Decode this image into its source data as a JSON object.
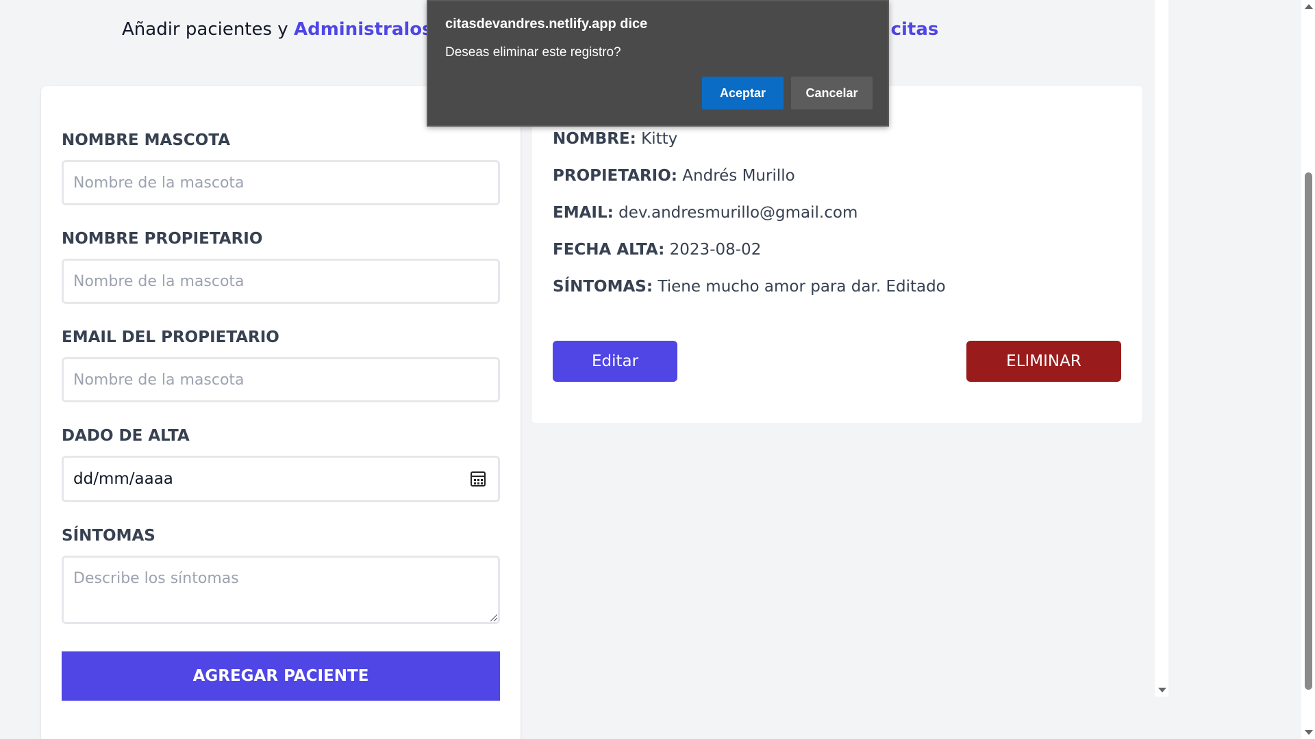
{
  "header": {
    "left_prefix": "Añadir pacientes y ",
    "left_accent": "Administralos",
    "right_accent": "tes y citas"
  },
  "form": {
    "pet_name_label": "NOMBRE MASCOTA",
    "pet_name_placeholder": "Nombre de la mascota",
    "owner_label": "NOMBRE PROPIETARIO",
    "owner_placeholder": "Nombre de la mascota",
    "email_label": "EMAIL DEL PROPIETARIO",
    "email_placeholder": "Nombre de la mascota",
    "date_label": "DADO DE ALTA",
    "date_value": "dd/mm/aaaa",
    "symptoms_label": "SÍNTOMAS",
    "symptoms_placeholder": "Describe los síntomas",
    "submit_label": "AGREGAR PACIENTE",
    "accent_color": "#4f46e5"
  },
  "patient": {
    "name_label": "NOMBRE:",
    "name_value": "Kitty",
    "owner_label": "PROPIETARIO:",
    "owner_value": "Andrés Murillo",
    "email_label": "EMAIL:",
    "email_value": "dev.andresmurillo@gmail.com",
    "date_label": "FECHA ALTA:",
    "date_value": "2023-08-02",
    "symptoms_label": "SÍNTOMAS:",
    "symptoms_value": "Tiene mucho amor para dar. Editado",
    "edit_label": "Editar",
    "delete_label": "ELIMINAR",
    "delete_color": "#991b1b"
  },
  "dialog": {
    "title": "citasdevandres.netlify.app dice",
    "message": "Deseas eliminar este registro?",
    "ok_label": "Aceptar",
    "cancel_label": "Cancelar",
    "ok_color": "#0a6cc4"
  },
  "icons": {
    "calendar": "calendar-icon",
    "resize": "resize-handle-icon",
    "scroll_up": "chevron-up-icon",
    "scroll_down": "chevron-down-icon"
  }
}
